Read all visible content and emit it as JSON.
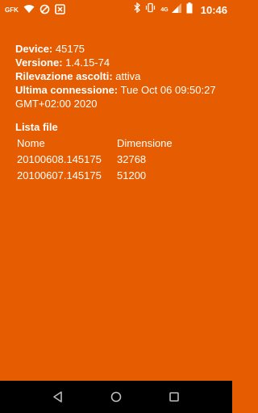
{
  "status": {
    "carrier_icon_label": "GFK",
    "network": "4G",
    "time": "10:46",
    "icons": [
      "gfk-icon",
      "wifi-icon",
      "no-signal-icon",
      "close-box-icon",
      "bluetooth-icon",
      "vibrate-icon",
      "cell-signal-icon",
      "battery-icon"
    ]
  },
  "device": {
    "label": "Device:",
    "value": "45175"
  },
  "version": {
    "label": "Versione:",
    "value": "1.4.15-74"
  },
  "listening": {
    "label": "Rilevazione ascolti:",
    "value": "attiva"
  },
  "last_connection": {
    "label": "Ultima connessione:",
    "value": "Tue Oct 06 09:50:27 GMT+02:00 2020"
  },
  "files": {
    "title": "Lista file",
    "headers": [
      "Nome",
      "Dimensione"
    ],
    "rows": [
      [
        "20100608.145175",
        "32768"
      ],
      [
        "20100607.145175",
        "51200"
      ]
    ]
  },
  "nav": {
    "icons": [
      "back-icon",
      "home-icon",
      "recents-icon"
    ]
  },
  "colors": {
    "background": "#E65C00",
    "nav_bar": "#000000",
    "text": "#FFFFFF"
  }
}
